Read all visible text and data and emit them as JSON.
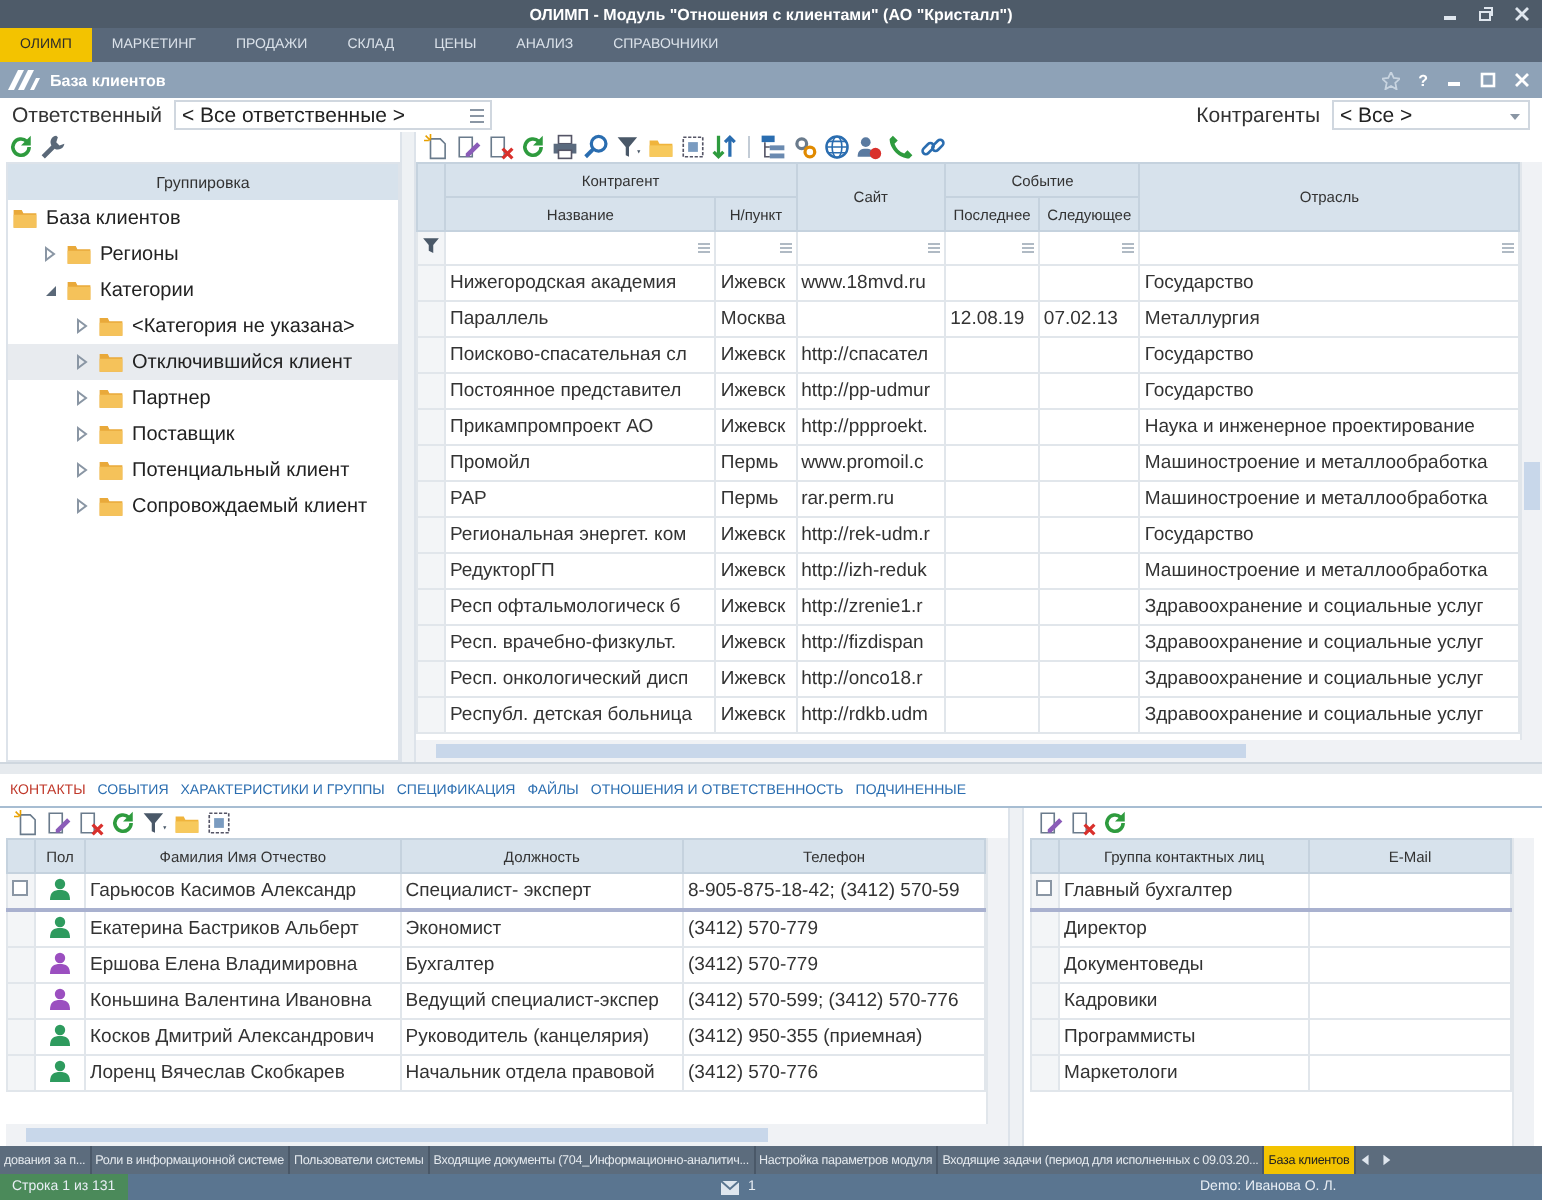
{
  "window": {
    "title": "ОЛИМП - Модуль \"Отношения с клиентами\" (АО \"Кристалл\")"
  },
  "menu": [
    {
      "label": "ОЛИМП",
      "selected": true
    },
    {
      "label": "МАРКЕТИНГ",
      "selected": false
    },
    {
      "label": "ПРОДАЖИ",
      "selected": false
    },
    {
      "label": "СКЛАД",
      "selected": false
    },
    {
      "label": "ЦЕНЫ",
      "selected": false
    },
    {
      "label": "АНАЛИЗ",
      "selected": false
    },
    {
      "label": "СПРАВОЧНИКИ",
      "selected": false
    }
  ],
  "panel": {
    "title": "База клиентов",
    "help": "?"
  },
  "filters": {
    "responsible": {
      "label": "Ответственный",
      "value": "< Все ответственные >"
    },
    "counterparties": {
      "label": "Контрагенты",
      "value": "< Все >"
    }
  },
  "tree": {
    "header": "Группировка",
    "items": [
      {
        "label": "База клиентов",
        "selected": false,
        "children": [
          {
            "label": "Регионы",
            "expanded": false,
            "selected": false
          },
          {
            "label": "Категории",
            "expanded": true,
            "selected": false,
            "children": [
              {
                "label": "<Категория не указана>",
                "expanded": false,
                "selected": false
              },
              {
                "label": "Отключившийся клиент",
                "expanded": false,
                "selected": true
              },
              {
                "label": "Партнер",
                "expanded": false,
                "selected": false
              },
              {
                "label": "Поставщик",
                "expanded": false,
                "selected": false
              },
              {
                "label": "Потенциальный клиент",
                "expanded": false,
                "selected": false
              },
              {
                "label": "Сопровождаемый клиент",
                "expanded": false,
                "selected": false
              }
            ]
          }
        ]
      }
    ]
  },
  "main_grid": {
    "groups": [
      {
        "label": "Контрагент",
        "columns": [
          "Название",
          "Н/пункт"
        ]
      },
      {
        "label": "Сайт"
      },
      {
        "label": "Событие",
        "columns": [
          "Последнее",
          "Следующее"
        ]
      },
      {
        "label": "Отрасль"
      }
    ],
    "rows": [
      [
        "Нижегородская академия",
        "Ижевск",
        "www.18mvd.ru",
        null,
        null,
        "Государство"
      ],
      [
        "Параллель",
        "Москва",
        null,
        "12.08.19",
        "07.02.13",
        "Металлургия"
      ],
      [
        "Поисково-спасательная сл",
        "Ижевск",
        "http://спасател",
        null,
        null,
        "Государство"
      ],
      [
        "Постоянное представител",
        "Ижевск",
        "http://pp-udmur",
        null,
        null,
        "Государство"
      ],
      [
        "Прикампромпроект АО",
        "Ижевск",
        "http://ppproekt.",
        null,
        null,
        "Наука и инженерное проектирование"
      ],
      [
        "Промойл",
        "Пермь",
        "www.promoil.c",
        null,
        null,
        "Машиностроение и металлообработка"
      ],
      [
        "РАР",
        "Пермь",
        "rar.perm.ru",
        null,
        null,
        "Машиностроение и металлообработка"
      ],
      [
        "Региональная энергет. ком",
        "Ижевск",
        "http://rek-udm.r",
        null,
        null,
        "Государство"
      ],
      [
        "РедукторГП",
        "Ижевск",
        "http://izh-reduk",
        null,
        null,
        "Машиностроение и металлообработка"
      ],
      [
        "Респ офтальмологическ б",
        "Ижевск",
        "http://zrenie1.r",
        null,
        null,
        "Здравоохранение и социальные услуг"
      ],
      [
        "Респ. врачебно-физкульт.",
        "Ижевск",
        "http://fizdispan",
        null,
        null,
        "Здравоохранение и социальные услуг"
      ],
      [
        "Респ. онкологический дисп",
        "Ижевск",
        "http://onco18.r",
        null,
        null,
        "Здравоохранение и социальные услуг"
      ],
      [
        "Республ. детская больница",
        "Ижевск",
        "http://rdkb.udm",
        null,
        null,
        "Здравоохранение и социальные услуг"
      ]
    ]
  },
  "detail_tabs": [
    {
      "label": "КОНТАКТЫ",
      "selected": true
    },
    {
      "label": "СОБЫТИЯ",
      "selected": false
    },
    {
      "label": "ХАРАКТЕРИСТИКИ И ГРУППЫ",
      "selected": false
    },
    {
      "label": "СПЕЦИФИКАЦИЯ",
      "selected": false
    },
    {
      "label": "ФАЙЛЫ",
      "selected": false
    },
    {
      "label": "ОТНОШЕНИЯ И ОТВЕТСТВЕННОСТЬ",
      "selected": false
    },
    {
      "label": "ПОДЧИНЕННЫЕ",
      "selected": false
    }
  ],
  "contacts": {
    "columns": [
      "Пол",
      "Фамилия Имя Отчество",
      "Должность",
      "Телефон"
    ],
    "rows": [
      {
        "focused": true,
        "color": "#2e9b5e",
        "cells": [
          null,
          "Гарьюсов Касимов Александр",
          "Специалист- эксперт",
          "8-905-875-18-42; (3412) 570-59"
        ]
      },
      {
        "focused": false,
        "color": "#2e9b5e",
        "cells": [
          null,
          "Екатерина Бастриков Альберт",
          "Экономист",
          "(3412) 570-779"
        ]
      },
      {
        "focused": false,
        "color": "#9b4fc0",
        "cells": [
          null,
          "Ершова Елена Владимировна",
          "Бухгалтер",
          "(3412) 570-779"
        ]
      },
      {
        "focused": false,
        "color": "#9b4fc0",
        "cells": [
          null,
          "Коньшина Валентина Ивановна",
          "Ведущий специалист-экспер",
          "(3412) 570-599; (3412) 570-776"
        ]
      },
      {
        "focused": false,
        "color": "#2e9b5e",
        "cells": [
          null,
          "Косков Дмитрий Александрович",
          "Руководитель (канцелярия)",
          "(3412) 950-355 (приемная)"
        ]
      },
      {
        "focused": false,
        "color": "#2e9b5e",
        "cells": [
          null,
          "Лоренц Вячеслав Скобкарев",
          "Начальник отдела правовой",
          "(3412) 570-776"
        ]
      }
    ]
  },
  "contact_groups": {
    "columns": [
      "Группа контактных лиц",
      "E-Mail"
    ],
    "rows": [
      {
        "focused": true,
        "cells": [
          "Главный бухгалтер",
          null
        ]
      },
      {
        "focused": false,
        "cells": [
          "Директор",
          null
        ]
      },
      {
        "focused": false,
        "cells": [
          "Документоведы",
          null
        ]
      },
      {
        "focused": false,
        "cells": [
          "Кадровики",
          null
        ]
      },
      {
        "focused": false,
        "cells": [
          "Программисты",
          null
        ]
      },
      {
        "focused": false,
        "cells": [
          "Маркетологи",
          null
        ]
      }
    ]
  },
  "taskbar": [
    {
      "label": "дования за п...",
      "selected": false
    },
    {
      "label": "Роли в информационной системе",
      "selected": false
    },
    {
      "label": "Пользователи системы",
      "selected": false
    },
    {
      "label": "Входящие документы (704_Информационно-аналитич...",
      "selected": false
    },
    {
      "label": "Настройка параметров модуля",
      "selected": false
    },
    {
      "label": "Входящие задачи (период для исполненных с 09.03.20...",
      "selected": false
    },
    {
      "label": "База клиентов",
      "selected": true
    }
  ],
  "status_bar": {
    "row_info": "Строка 1 из 131",
    "messages": "1",
    "user": "Demo: Иванова О. Л."
  }
}
